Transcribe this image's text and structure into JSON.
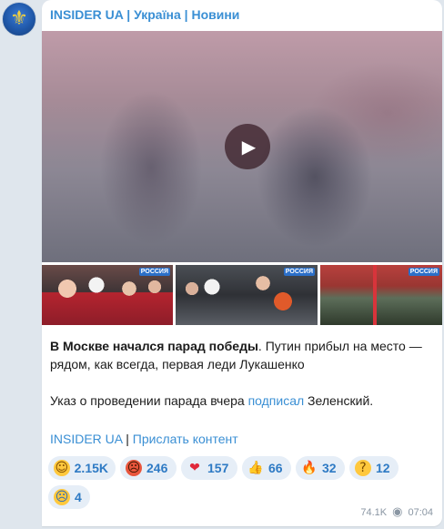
{
  "channel": {
    "title": "INSIDER UA | Україна | Новини",
    "avatar_icon": "trident-icon"
  },
  "video": {
    "play_icon": "play-icon"
  },
  "photos": [
    {
      "name": "photo-1",
      "logo": "РОССИЯ"
    },
    {
      "name": "photo-2",
      "logo": "РОССИЯ"
    },
    {
      "name": "photo-3",
      "logo": "РОССИЯ"
    }
  ],
  "message": {
    "bold_lead": "В Москве начался парад победы",
    "line1_rest": ". Путин прибыл на место — рядом, как всегда, первая леди Лукашенко",
    "line2_before": "Указ о проведении парада вчера ",
    "line2_link": "подписал",
    "line2_after": " Зеленский."
  },
  "footer": {
    "link1": "INSIDER UA",
    "separator": " | ",
    "link2": "Прислать контент"
  },
  "reactions": [
    {
      "icon": "laughing-emoji-icon",
      "glyph": "☺",
      "count": "2.15K"
    },
    {
      "icon": "angry-emoji-icon",
      "glyph": "☹",
      "count": "246"
    },
    {
      "icon": "heart-emoji-icon",
      "glyph": "❤",
      "count": "157"
    },
    {
      "icon": "thumbs-up-emoji-icon",
      "glyph": "👍",
      "count": "66"
    },
    {
      "icon": "fire-emoji-icon",
      "glyph": "🔥",
      "count": "32"
    },
    {
      "icon": "thinking-emoji-icon",
      "glyph": "?",
      "count": "12"
    },
    {
      "icon": "crying-emoji-icon",
      "glyph": "☹",
      "count": "4"
    }
  ],
  "meta": {
    "views": "74.1K",
    "time": "07:04"
  },
  "colors": {
    "link": "#3a8fd4",
    "reaction_bg": "#e6eef7",
    "reaction_text": "#2e7ac4",
    "chat_bg": "#dfe6ed"
  }
}
